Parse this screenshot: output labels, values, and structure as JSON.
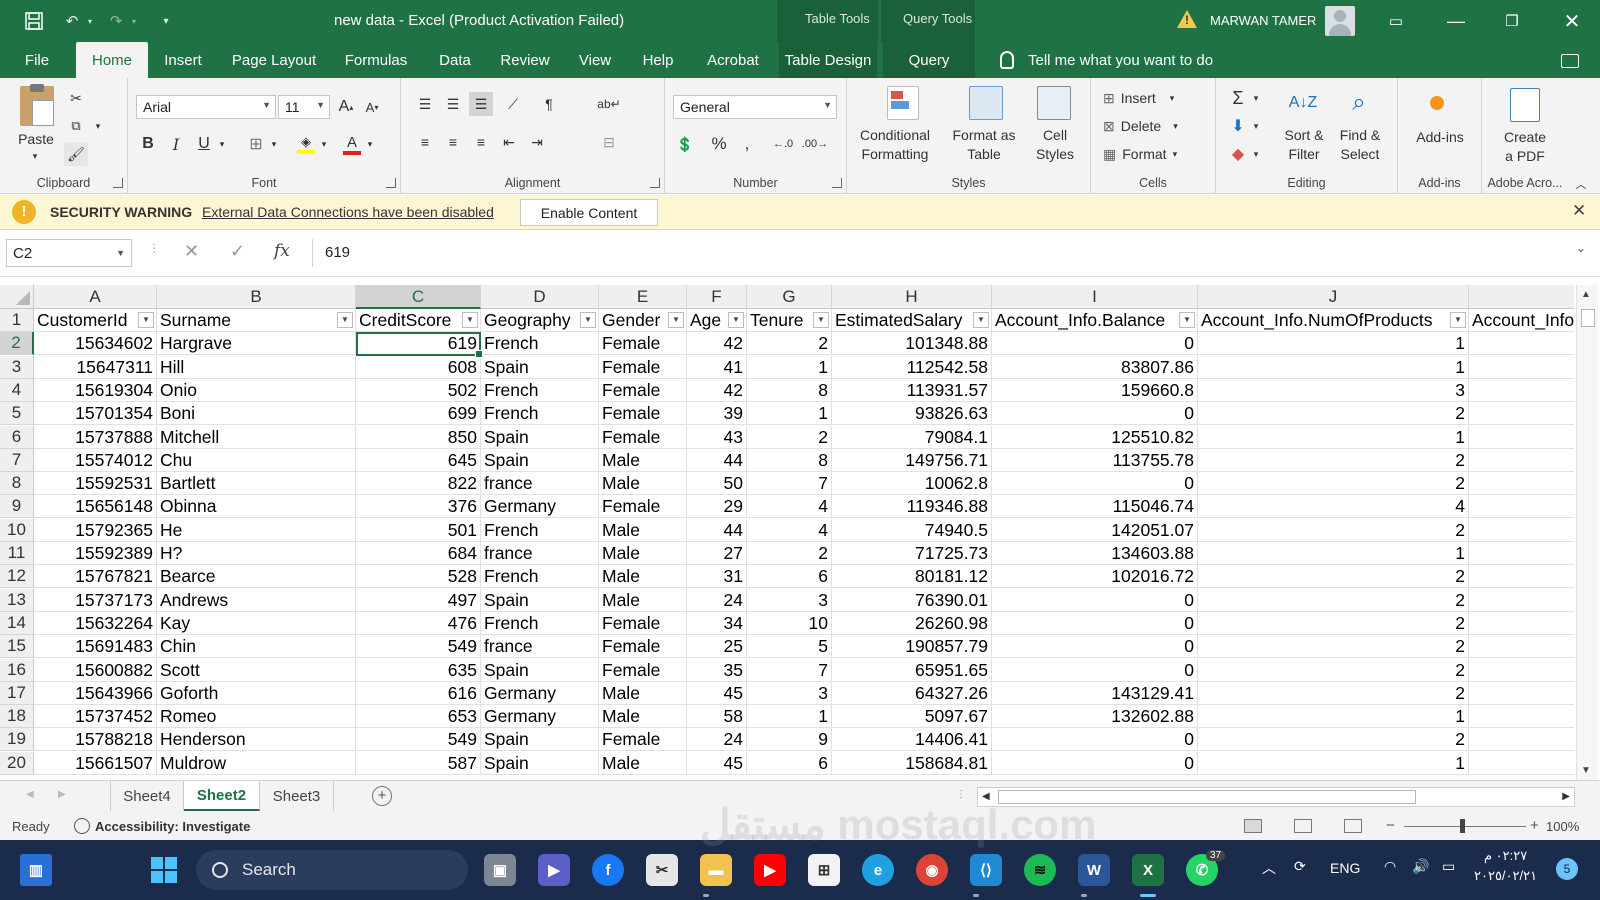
{
  "titlebar": {
    "doc_title": "new data  -  Excel (Product Activation Failed)",
    "context_table_tools": "Table Tools",
    "context_query_tools": "Query Tools",
    "user_name": "MARWAN TAMER"
  },
  "ribbon_tabs": [
    "File",
    "Home",
    "Insert",
    "Page Layout",
    "Formulas",
    "Data",
    "Review",
    "View",
    "Help",
    "Acrobat",
    "Table Design",
    "Query"
  ],
  "active_tab": "Home",
  "tell_me": "Tell me what you want to do",
  "ribbon": {
    "clipboard": {
      "label": "Clipboard",
      "paste": "Paste"
    },
    "font": {
      "label": "Font",
      "name": "Arial",
      "size": "11"
    },
    "alignment": {
      "label": "Alignment"
    },
    "number": {
      "label": "Number",
      "format": "General"
    },
    "styles": {
      "label": "Styles",
      "conditional": "Conditional\nFormatting",
      "format_table": "Format as\nTable",
      "cell_styles": "Cell\nStyles"
    },
    "cells": {
      "label": "Cells",
      "insert": "Insert",
      "delete": "Delete",
      "format": "Format"
    },
    "editing": {
      "label": "Editing",
      "sort_filter": "Sort &\nFilter",
      "find_select": "Find &\nSelect"
    },
    "addins": {
      "label": "Add-ins",
      "button": "Add-ins"
    },
    "adobe": {
      "label": "Adobe Acro...",
      "button": "Create\na PDF"
    }
  },
  "security": {
    "title": "SECURITY WARNING",
    "message": "External Data Connections have been disabled",
    "button": "Enable Content"
  },
  "formula_bar": {
    "name_box": "C2",
    "value": "619"
  },
  "columns": [
    "A",
    "B",
    "C",
    "D",
    "E",
    "F",
    "G",
    "H",
    "I",
    "J",
    ""
  ],
  "headers": [
    "CustomerId",
    "Surname",
    "CreditScore",
    "Geography",
    "Gender",
    "Age",
    "Tenure",
    "EstimatedSalary",
    "Account_Info.Balance",
    "Account_Info.NumOfProducts",
    "Account_Info"
  ],
  "rows": [
    [
      "2",
      "15634602",
      "Hargrave",
      "619",
      "French",
      "Female",
      "42",
      "2",
      "101348.88",
      "0",
      "1"
    ],
    [
      "3",
      "15647311",
      "Hill",
      "608",
      "Spain",
      "Female",
      "41",
      "1",
      "112542.58",
      "83807.86",
      "1"
    ],
    [
      "4",
      "15619304",
      "Onio",
      "502",
      "French",
      "Female",
      "42",
      "8",
      "113931.57",
      "159660.8",
      "3"
    ],
    [
      "5",
      "15701354",
      "Boni",
      "699",
      "French",
      "Female",
      "39",
      "1",
      "93826.63",
      "0",
      "2"
    ],
    [
      "6",
      "15737888",
      "Mitchell",
      "850",
      "Spain",
      "Female",
      "43",
      "2",
      "79084.1",
      "125510.82",
      "1"
    ],
    [
      "7",
      "15574012",
      "Chu",
      "645",
      "Spain",
      "Male",
      "44",
      "8",
      "149756.71",
      "113755.78",
      "2"
    ],
    [
      "8",
      "15592531",
      "Bartlett",
      "822",
      "france",
      "Male",
      "50",
      "7",
      "10062.8",
      "0",
      "2"
    ],
    [
      "9",
      "15656148",
      "Obinna",
      "376",
      "Germany",
      "Female",
      "29",
      "4",
      "119346.88",
      "115046.74",
      "4"
    ],
    [
      "10",
      "15792365",
      "He",
      "501",
      "French",
      "Male",
      "44",
      "4",
      "74940.5",
      "142051.07",
      "2"
    ],
    [
      "11",
      "15592389",
      "H?",
      "684",
      "france",
      "Male",
      "27",
      "2",
      "71725.73",
      "134603.88",
      "1"
    ],
    [
      "12",
      "15767821",
      "Bearce",
      "528",
      "French",
      "Male",
      "31",
      "6",
      "80181.12",
      "102016.72",
      "2"
    ],
    [
      "13",
      "15737173",
      "Andrews",
      "497",
      "Spain",
      "Male",
      "24",
      "3",
      "76390.01",
      "0",
      "2"
    ],
    [
      "14",
      "15632264",
      "Kay",
      "476",
      "French",
      "Female",
      "34",
      "10",
      "26260.98",
      "0",
      "2"
    ],
    [
      "15",
      "15691483",
      "Chin",
      "549",
      "france",
      "Female",
      "25",
      "5",
      "190857.79",
      "0",
      "2"
    ],
    [
      "16",
      "15600882",
      "Scott",
      "635",
      "Spain",
      "Female",
      "35",
      "7",
      "65951.65",
      "0",
      "2"
    ],
    [
      "17",
      "15643966",
      "Goforth",
      "616",
      "Germany",
      "Male",
      "45",
      "3",
      "64327.26",
      "143129.41",
      "2"
    ],
    [
      "18",
      "15737452",
      "Romeo",
      "653",
      "Germany",
      "Male",
      "58",
      "1",
      "5097.67",
      "132602.88",
      "1"
    ],
    [
      "19",
      "15788218",
      "Henderson",
      "549",
      "Spain",
      "Female",
      "24",
      "9",
      "14406.41",
      "0",
      "2"
    ],
    [
      "20",
      "15661507",
      "Muldrow",
      "587",
      "Spain",
      "Male",
      "45",
      "6",
      "158684.81",
      "0",
      "1"
    ]
  ],
  "sheets": [
    "Sheet4",
    "Sheet2",
    "Sheet3"
  ],
  "active_sheet": "Sheet2",
  "status": {
    "ready": "Ready",
    "accessibility": "Accessibility: Investigate",
    "zoom": "100%"
  },
  "taskbar": {
    "search": "Search",
    "lang": "ENG",
    "time": "٠٢:٢٧ م",
    "date": "٢٠٢٥/٠٢/٢١",
    "whatsapp_badge": "37",
    "notifications": "5"
  },
  "watermark": "مستقل mostaql.com",
  "colors": {
    "excel_green": "#1f7244",
    "security_bg": "#fdf6d2",
    "taskbar": "#1a2b4c"
  }
}
